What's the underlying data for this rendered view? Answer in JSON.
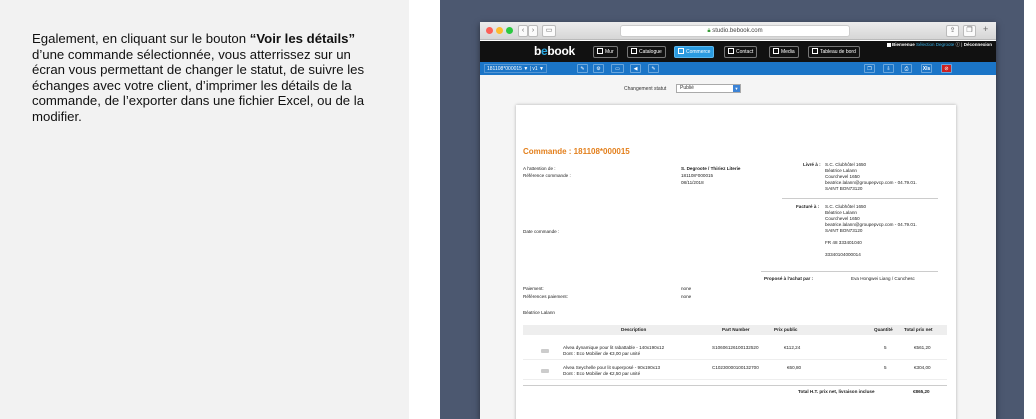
{
  "instructions": {
    "text_before": "Egalement, en cliquant sur le bouton ",
    "bold": "“Voir les détails”",
    "text_after": " d’une commande sélectionnée, vous atterrissez sur un écran vous permettant de changer le statut, de suivre les échanges avec votre client, d’imprimer les détails de la commande, de l’exporter dans une fichier Excel, ou de la modifier."
  },
  "browser": {
    "url": "studio.bebook.com",
    "nav_back": "‹",
    "nav_forward": "›"
  },
  "app": {
    "logo_pre": "b",
    "logo_e": "e",
    "logo_post": "book",
    "nav": [
      "Mur",
      "Catalogue",
      "Commerce",
      "Contact",
      "Media",
      "Tableau de bord"
    ],
    "user_welcome": "Bienvenue",
    "user_name": "Sélection Degroote",
    "user_sep": "|",
    "logout": "Déconnexion"
  },
  "toolbar": {
    "order_select": "181108*000015 ▼ | v1 ▼",
    "export_label": "Xls"
  },
  "status": {
    "label": "Changement statut",
    "value": "Publié"
  },
  "order": {
    "title": "Commande : 181108*000015",
    "attention_label": "A l'attention de :",
    "ref_label": "Référence commande :",
    "attention_value": "S. Degroote / Thiriez Literie",
    "ref_value": "181108*000015",
    "order_date_value": "08/11/2018",
    "delivered_label": "Livré à :",
    "delivered_lines": [
      "S.C. Clubhôtel 1650",
      "Béatrice Lalann",
      "Courchevel 1650",
      "beatrice.lalann@groupepvcp.com - 04.79.01.",
      "SAINT BON73120"
    ],
    "billed_label": "Facturé à :",
    "billed_lines": [
      "S.C. Clubhôtel 1650",
      "Béatrice Lalann",
      "Courchevel 1650",
      "beatrice.lalann@groupepvcp.com - 04.79.01.",
      "SAINT BON73120",
      "",
      "FR 48 333401040",
      "",
      "33340104000014"
    ],
    "date_label": "Date commande :",
    "proposed_label": "Proposé à l'achat par :",
    "proposed_value": "Eva Hongwei Liang / Cunchesc",
    "payment_label": "Paiement:",
    "payment_value": "none",
    "payment_ref_label": "Références paiement:",
    "payment_ref_value": "none",
    "contact": "Béatrice Lalann"
  },
  "table": {
    "headers": [
      "Description",
      "Part Number",
      "Prix public",
      "Quantité",
      "Total prix net"
    ],
    "rows": [
      {
        "desc1": "Alvea dynamique pour lit rabattable - 140x190x12",
        "desc2": "Dont : Eco Mobilier de €3,00 par unité",
        "part": "S10606126100132520",
        "price": "€112,24",
        "qty": "5",
        "total": "€561,20"
      },
      {
        "desc1": "Alvea Seychelle pour lit superposé - 90x190x13",
        "desc2": "Dont : Eco Mobilier de €2,50 par unité",
        "part": "C10230000100132700",
        "price": "€60,80",
        "qty": "5",
        "total": "€304,00"
      }
    ],
    "total_label": "Total H.T. prix net, livraison incluse",
    "total_value": "€865,20"
  }
}
